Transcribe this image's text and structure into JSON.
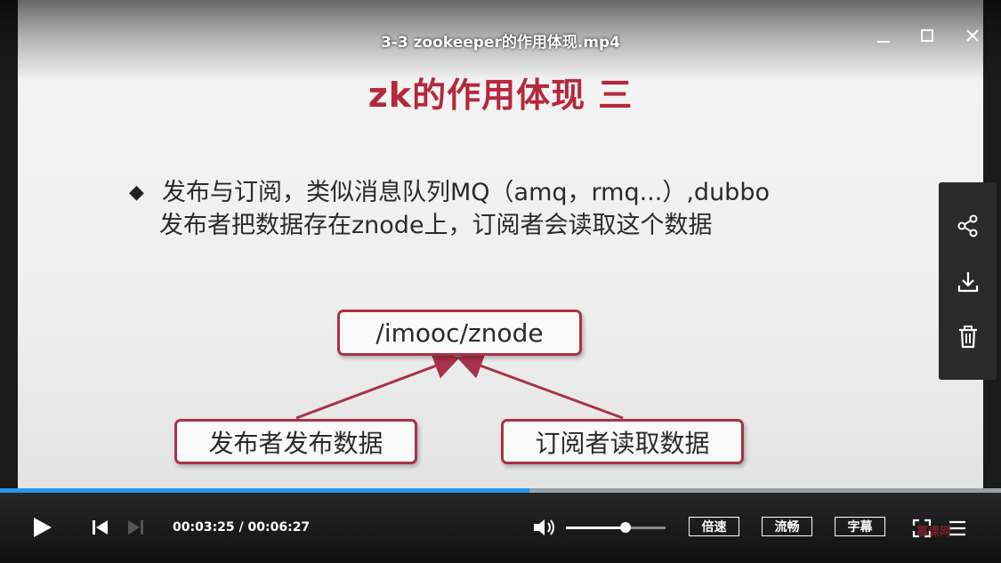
{
  "window": {
    "title": "3-3 zookeeper的作用体现.mp4",
    "minimize_icon": "minimize-icon",
    "maximize_icon": "maximize-icon",
    "close_icon": "close-icon"
  },
  "slide": {
    "title": "zk的作用体现 三",
    "bullet_mark": "◆",
    "bullet_line1": "发布与订阅，类似消息队列MQ（amq，rmq...）,dubbo",
    "bullet_line2": "发布者把数据存在znode上，订阅者会读取这个数据",
    "diagram": {
      "top_node": "/imooc/znode",
      "left_node": "发布者发布数据",
      "right_node": "订阅者读取数据"
    },
    "colors": {
      "title": "#b5283c",
      "node_border": "#a8324a"
    }
  },
  "side_panel": {
    "icons": [
      "share-icon",
      "download-icon",
      "trash-icon"
    ]
  },
  "controls": {
    "current_time": "00:03:25",
    "total_time": "00:06:27",
    "time_separator": " / ",
    "progress_fraction": 0.529,
    "volume_fraction": 0.6,
    "speed_label": "倍速",
    "quality_label": "流畅",
    "subtitle_label": "字幕",
    "watermark": "慕课网",
    "icons": [
      "play-icon",
      "previous-icon",
      "next-icon",
      "volume-icon",
      "fullscreen-icon",
      "playlist-icon"
    ],
    "accent_color": "#2196f3"
  }
}
